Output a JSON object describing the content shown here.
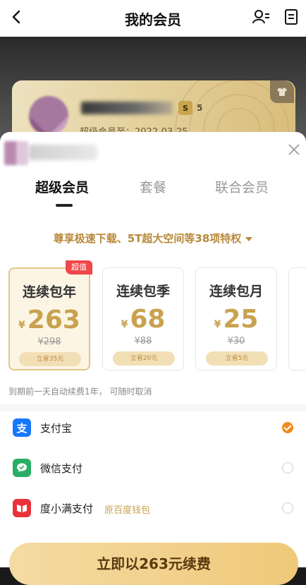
{
  "header": {
    "title": "我的会员"
  },
  "card": {
    "level": "5",
    "expire_label": "超级会员至：2022-03-25"
  },
  "tabs": [
    {
      "label": "超级会员",
      "active": true
    },
    {
      "label": "套餐",
      "active": false
    },
    {
      "label": "联合会员",
      "active": false
    }
  ],
  "privilege_text": "尊享极速下载、5T超大空间等38项特权",
  "badge_label": "超值",
  "currency": "¥",
  "plans": [
    {
      "name": "连续包年",
      "price": "263",
      "original": "¥298",
      "save": "立省35元",
      "selected": true
    },
    {
      "name": "连续包季",
      "price": "68",
      "original": "¥88",
      "save": "立省20元",
      "selected": false
    },
    {
      "name": "连续包月",
      "price": "25",
      "original": "¥30",
      "save": "立省5元",
      "selected": false
    }
  ],
  "renew_note": "到期前一天自动续费1年， 可随时取消",
  "payments": [
    {
      "label": "支付宝",
      "sub": "",
      "selected": true,
      "icon": "alipay-icon",
      "color": "#1677ff",
      "glyph": "支"
    },
    {
      "label": "微信支付",
      "sub": "",
      "selected": false,
      "icon": "wechat-pay-icon",
      "color": "#2aae67",
      "glyph": "微"
    },
    {
      "label": "度小满支付",
      "sub": "原百度钱包",
      "selected": false,
      "icon": "duxiaoman-icon",
      "color": "#e8333a",
      "glyph": "度"
    }
  ],
  "cta_label": "立即以263元续费"
}
